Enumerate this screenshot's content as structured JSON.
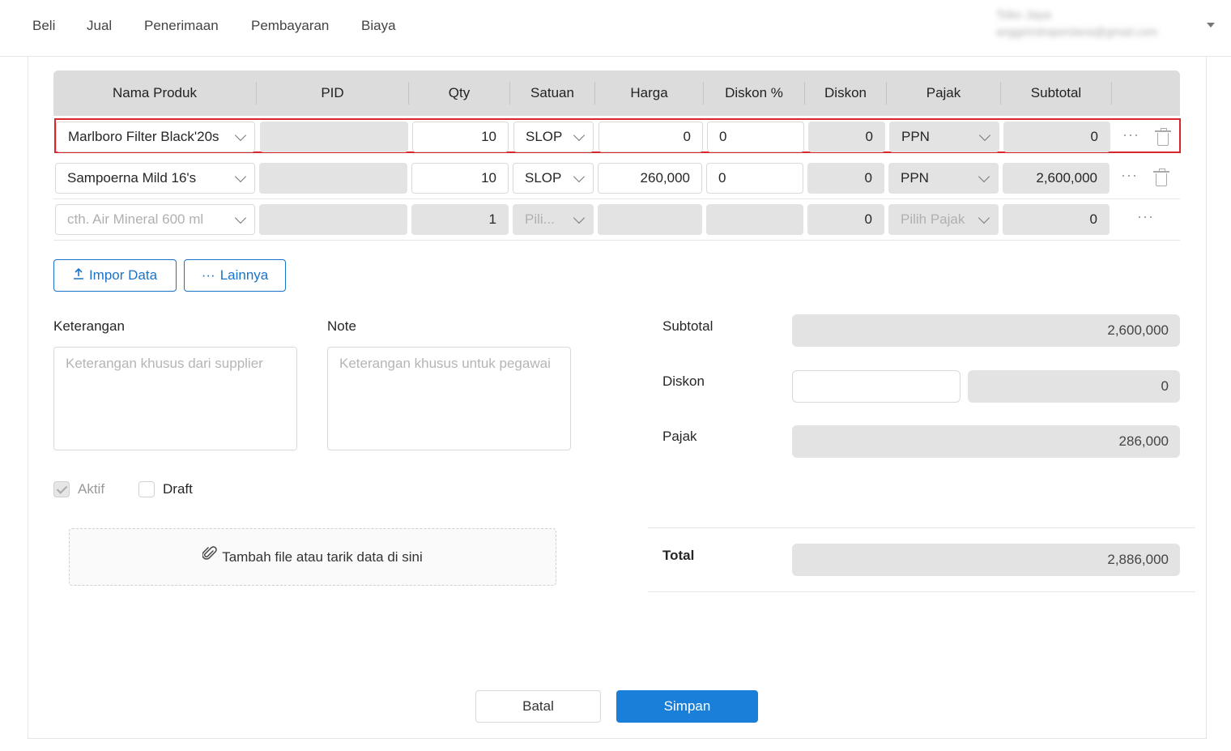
{
  "nav": {
    "items": [
      "Beli",
      "Jual",
      "Penerimaan",
      "Pembayaran",
      "Biaya"
    ],
    "user_name": "Toko Jaya",
    "user_email": "anggirindraperdana@gmail.com"
  },
  "table": {
    "headers": [
      "Nama Produk",
      "PID",
      "Qty",
      "Satuan",
      "Harga",
      "Diskon %",
      "Diskon",
      "Pajak",
      "Subtotal"
    ],
    "rows": [
      {
        "product": "Marlboro Filter Black'20s",
        "pid": "",
        "qty": "10",
        "unit": "SLOP",
        "price": "0",
        "disc_pct": "0",
        "disc": "0",
        "tax": "PPN",
        "subtotal": "0"
      },
      {
        "product": "Sampoerna Mild 16's",
        "pid": "",
        "qty": "10",
        "unit": "SLOP",
        "price": "260,000",
        "disc_pct": "0",
        "disc": "0",
        "tax": "PPN",
        "subtotal": "2,600,000"
      },
      {
        "product": "cth. Air Mineral 600 ml",
        "pid": "",
        "qty": "1",
        "unit": "Pili...",
        "price": "",
        "disc_pct": "",
        "disc": "0",
        "tax": "Pilih Pajak",
        "subtotal": "0"
      }
    ],
    "more_glyph": "···"
  },
  "actions": {
    "import_label": "Impor Data",
    "more_label": "Lainnya",
    "import_icon": "upload-icon",
    "more_icon": "ellipsis-icon"
  },
  "notes": {
    "keterangan_label": "Keterangan",
    "keterangan_placeholder": "Keterangan khusus dari supplier",
    "note_label": "Note",
    "note_placeholder": "Keterangan khusus untuk pegawai"
  },
  "flags": {
    "aktif_label": "Aktif",
    "aktif_checked": true,
    "draft_label": "Draft",
    "draft_checked": false
  },
  "attach": {
    "label": "Tambah file atau tarik data di sini",
    "icon": "paperclip-icon"
  },
  "summary": {
    "subtotal_label": "Subtotal",
    "subtotal_value": "2,600,000",
    "diskon_label": "Diskon",
    "diskon_input": "",
    "diskon_value": "0",
    "pajak_label": "Pajak",
    "pajak_value": "286,000",
    "total_label": "Total",
    "total_value": "2,886,000"
  },
  "footer": {
    "cancel_label": "Batal",
    "save_label": "Simpan"
  },
  "colors": {
    "primary": "#1a7fd9",
    "selected_border": "#d9262c",
    "readonly_bg": "#e3e3e3",
    "header_bg": "#dcdcdc"
  }
}
